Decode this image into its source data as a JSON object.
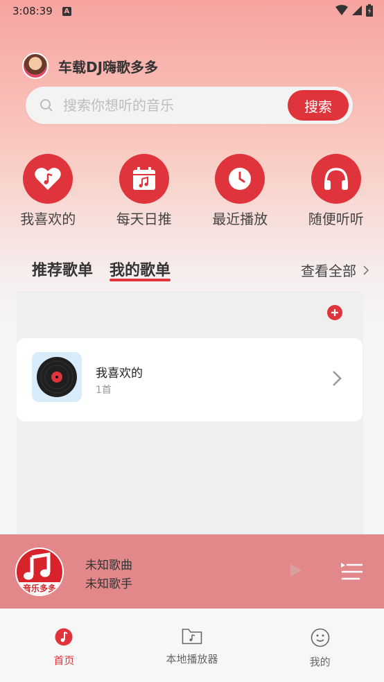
{
  "status_bar": {
    "time": "3:08:39",
    "indicator": "A"
  },
  "header": {
    "app_name": "车载DJ嗨歌多多"
  },
  "search": {
    "placeholder": "搜索你想听的音乐",
    "button_label": "搜索"
  },
  "quick_actions": [
    {
      "label": "我喜欢的",
      "icon": "heart-note-icon"
    },
    {
      "label": "每天日推",
      "icon": "calendar-note-icon"
    },
    {
      "label": "最近播放",
      "icon": "clock-icon"
    },
    {
      "label": "随便听听",
      "icon": "headphones-icon"
    }
  ],
  "tabs": [
    {
      "label": "推荐歌单",
      "active": false
    },
    {
      "label": "我的歌单",
      "active": true
    }
  ],
  "view_all_label": "查看全部",
  "playlists": [
    {
      "title": "我喜欢的",
      "count": "1首"
    }
  ],
  "mini_player": {
    "song": "未知歌曲",
    "artist": "未知歌手",
    "cover_text": "音乐多多"
  },
  "bottom_nav": [
    {
      "label": "首页",
      "active": true,
      "icon": "music-note-icon"
    },
    {
      "label": "本地播放器",
      "active": false,
      "icon": "folder-music-icon"
    },
    {
      "label": "我的",
      "active": false,
      "icon": "smiley-icon"
    }
  ],
  "colors": {
    "accent": "#e0343d",
    "player_bg": "#e2888b"
  }
}
